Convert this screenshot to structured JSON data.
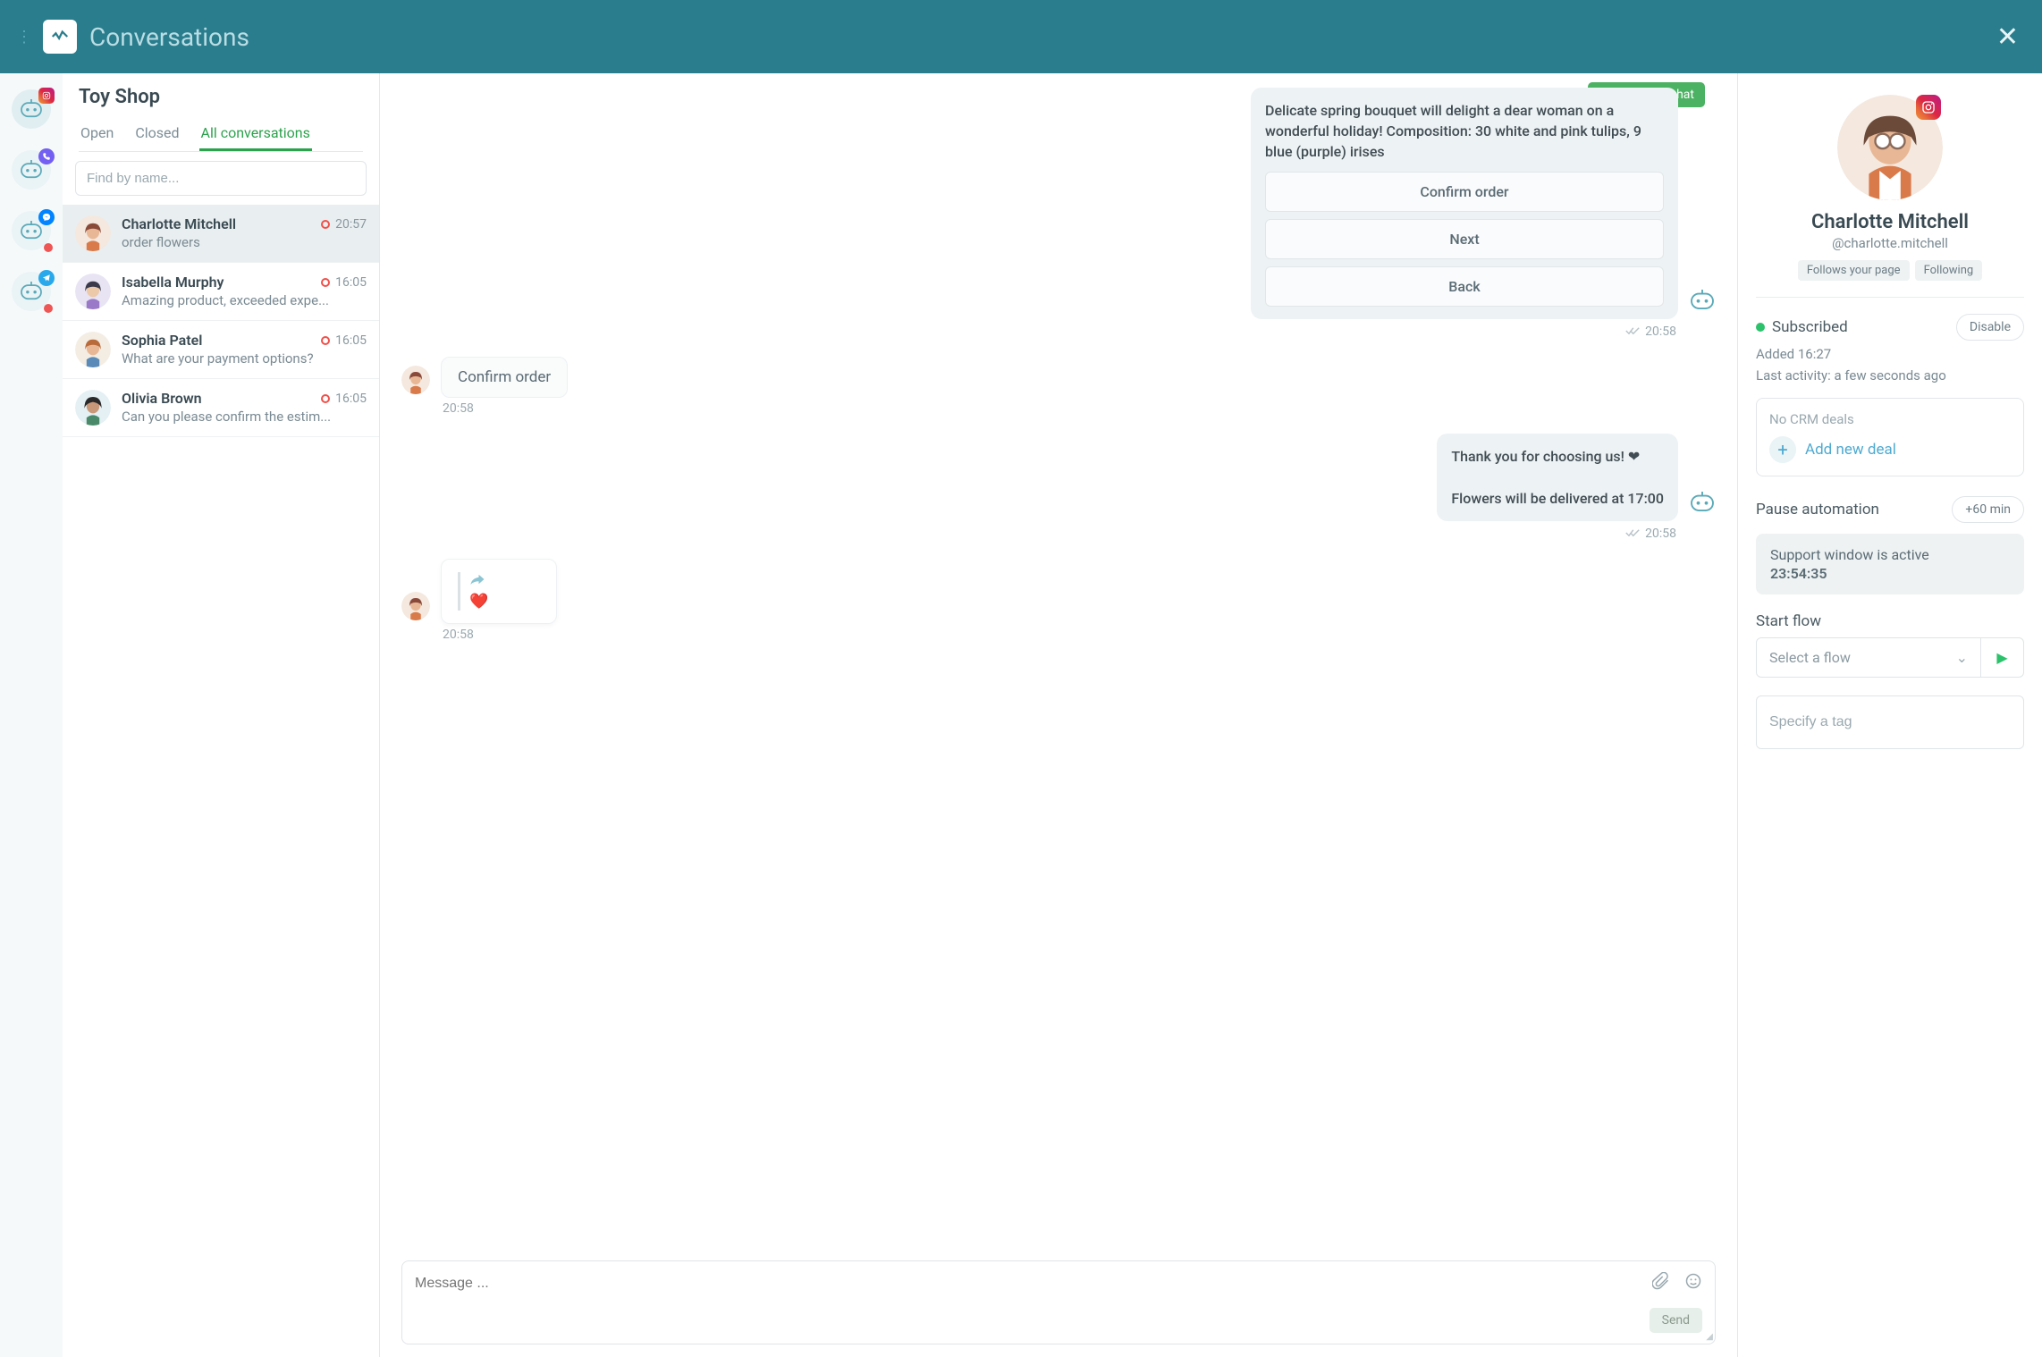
{
  "titlebar": {
    "title": "Conversations"
  },
  "channels": [
    {
      "id": "instagram",
      "active": true,
      "dot": false
    },
    {
      "id": "viber",
      "active": false,
      "dot": false
    },
    {
      "id": "facebook",
      "active": false,
      "dot": true
    },
    {
      "id": "telegram",
      "active": false,
      "dot": true
    }
  ],
  "list": {
    "shop_name": "Toy Shop",
    "tabs": {
      "open": "Open",
      "closed": "Closed",
      "all": "All conversations",
      "active": "all"
    },
    "search_placeholder": "Find by name...",
    "items": [
      {
        "name": "Charlotte Mitchell",
        "preview": "order flowers",
        "time": "20:57",
        "unread": true,
        "selected": true,
        "avatar": "cm"
      },
      {
        "name": "Isabella Murphy",
        "preview": "Amazing product, exceeded expe...",
        "time": "16:05",
        "unread": true,
        "avatar": "im"
      },
      {
        "name": "Sophia Patel",
        "preview": "What are your payment options?",
        "time": "16:05",
        "unread": true,
        "avatar": "sp"
      },
      {
        "name": "Olivia Brown",
        "preview": "Can you please confirm the estim...",
        "time": "16:05",
        "unread": true,
        "avatar": "ob"
      }
    ]
  },
  "chat": {
    "close_label": "Close the chat",
    "messages": [
      {
        "from": "bot",
        "text": "Delicate spring bouquet will delight a dear woman on a wonderful holiday! Composition: 30 white and pink tulips, 9 blue (purple) irises",
        "buttons": [
          "Confirm order",
          "Next",
          "Back"
        ],
        "time": "20:58"
      },
      {
        "from": "user",
        "text": "Confirm order",
        "time": "20:58"
      },
      {
        "from": "bot",
        "text": "Thank you for choosing us! ❤\n\nFlowers will be delivered at 17:00",
        "time": "20:58"
      },
      {
        "from": "user_reaction",
        "emoji": "❤️",
        "time": "20:58"
      }
    ],
    "composer": {
      "placeholder": "Message ...",
      "send": "Send"
    }
  },
  "details": {
    "name": "Charlotte Mitchell",
    "handle": "@charlotte.mitchell",
    "pills": [
      "Follows your page",
      "Following"
    ],
    "subscribed_label": "Subscribed",
    "disable_label": "Disable",
    "added": "Added 16:27",
    "last_activity": "Last activity: a few seconds ago",
    "crm_none": "No CRM deals",
    "add_deal": "Add new deal",
    "pause_label": "Pause automation",
    "pause_btn": "+60 min",
    "support_window_text": "Support window is active",
    "support_window_time": "23:54:35",
    "start_flow_label": "Start flow",
    "flow_placeholder": "Select a flow",
    "tag_placeholder": "Specify a tag"
  }
}
